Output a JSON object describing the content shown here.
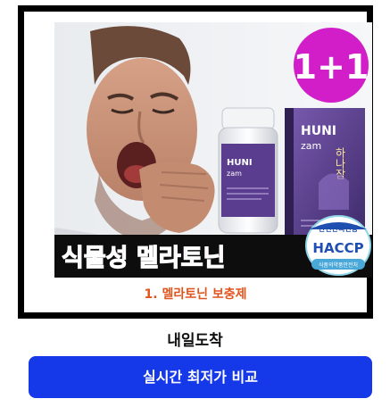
{
  "promo": {
    "badge": "1+1",
    "banner_text": "식물성 멜라토닌",
    "brand": "HUNI",
    "brand_sub": "zam",
    "box_vertical_text": "하나잠",
    "certification_top": "안전관리인증",
    "certification_main": "HACCP",
    "certification_bottom": "식품의약품안전처"
  },
  "product": {
    "name": "1. 멜라토닌 보충제"
  },
  "shipping": {
    "label": "내일도착"
  },
  "actions": {
    "compare_label": "실시간 최저가 비교"
  },
  "colors": {
    "accent_orange": "#e0541e",
    "button_blue": "#1538e8",
    "badge_magenta": "#d21ec9",
    "banner_text_magenta": "#ee3fd5",
    "product_purple": "#5a3d8e"
  }
}
